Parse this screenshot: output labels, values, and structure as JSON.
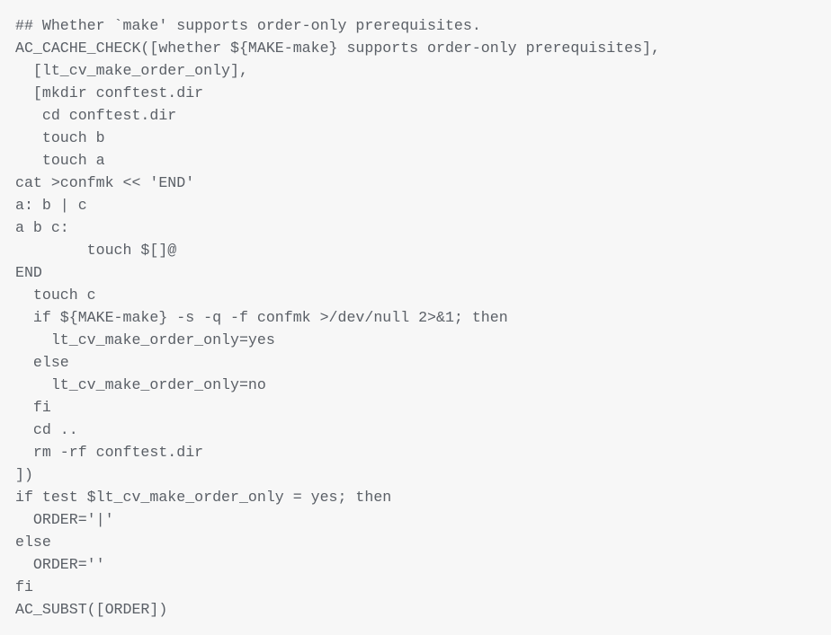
{
  "document": {
    "kind": "source-code-listing",
    "language": "m4sh",
    "background_color": "#f7f7f7",
    "text_color": "#5a5f66",
    "font_kind": "monospace",
    "line_count": 27,
    "lines": [
      "## Whether `make' supports order-only prerequisites.",
      "AC_CACHE_CHECK([whether ${MAKE-make} supports order-only prerequisites],",
      "  [lt_cv_make_order_only],",
      "  [mkdir conftest.dir",
      "   cd conftest.dir",
      "   touch b",
      "   touch a",
      "cat >confmk << 'END'",
      "a: b | c",
      "a b c:",
      "        touch $[]@",
      "END",
      "  touch c",
      "  if ${MAKE-make} -s -q -f confmk >/dev/null 2>&1; then",
      "    lt_cv_make_order_only=yes",
      "  else",
      "    lt_cv_make_order_only=no",
      "  fi",
      "  cd ..",
      "  rm -rf conftest.dir",
      "])",
      "if test $lt_cv_make_order_only = yes; then",
      "  ORDER='|'",
      "else",
      "  ORDER=''",
      "fi",
      "AC_SUBST([ORDER])"
    ]
  }
}
